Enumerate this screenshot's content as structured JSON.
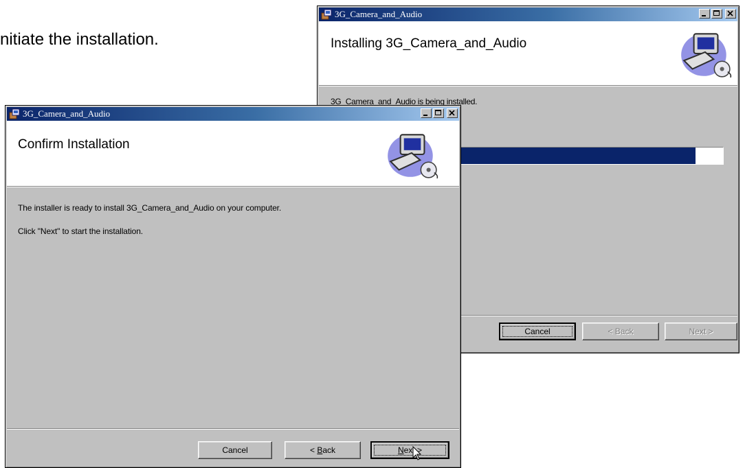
{
  "document": {
    "text": "nitiate the installation."
  },
  "back_window": {
    "title": "3G_Camera_and_Audio",
    "banner_title": "Installing 3G_Camera_and_Audio",
    "status_text": "3G_Camera_and_Audio is being installed.",
    "progress": 0.93,
    "buttons": {
      "cancel": "Cancel",
      "back": "< Back",
      "next": "Next >"
    }
  },
  "front_window": {
    "title": "3G_Camera_and_Audio",
    "banner_title": "Confirm Installation",
    "line1": "The installer is ready to install 3G_Camera_and_Audio on your computer.",
    "line2": "Click \"Next\" to start the installation.",
    "buttons": {
      "cancel": "Cancel",
      "back_prefix": "< ",
      "back_mnemonic": "B",
      "back_rest": "ack",
      "next_prefix": "",
      "next_mnemonic": "N",
      "next_rest": "ext >"
    }
  },
  "colors": {
    "titlebar_start": "#0a246a",
    "titlebar_end": "#a6caf0",
    "face": "#c0c0c0",
    "progress_fill": "#0a246a"
  },
  "icons": [
    "setup-icon",
    "minimize-icon",
    "maximize-icon",
    "close-icon",
    "computer-cd-icon",
    "mouse-cursor-icon"
  ]
}
